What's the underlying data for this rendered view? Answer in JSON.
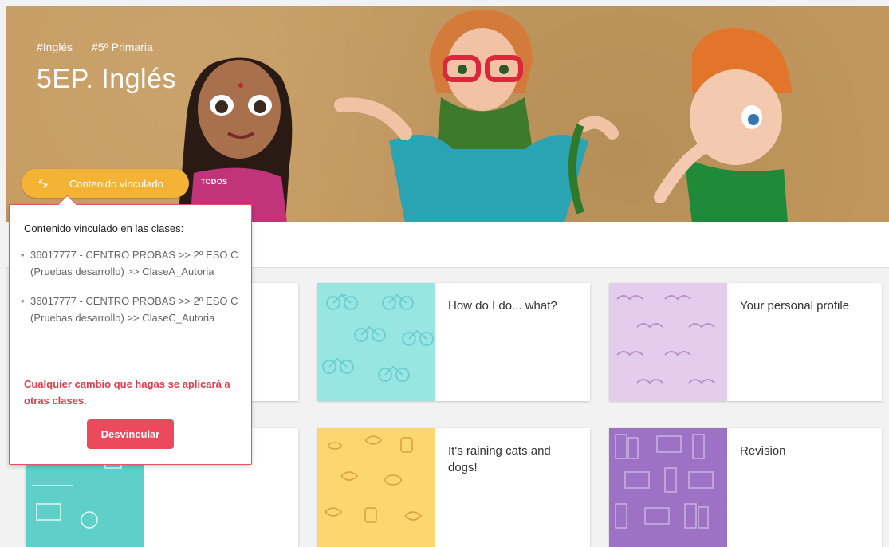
{
  "hero": {
    "tags": [
      "#Inglés",
      "#5º Primaria"
    ],
    "title": "5EP. Inglés",
    "linked_button_label": "Contenido vinculado",
    "linked_icon": "link-icon",
    "todos_tab_label": "TODOS"
  },
  "popover": {
    "heading": "Contenido vinculado en las clases:",
    "classes": [
      "36017777 - CENTRO PROBAS >> 2º ESO C (Pruebas desarrollo) >> ClaseA_Autoria",
      "36017777 - CENTRO PROBAS >> 2º ESO C (Pruebas desarrollo) >> ClaseC_Autoria"
    ],
    "warning": "Cualquier cambio que hagas se aplicará a otras clases.",
    "unlink_button": "Desvincular"
  },
  "cards": [
    {
      "title": "How do I do... what?",
      "pattern": "bicycles"
    },
    {
      "title": "Your personal profile",
      "pattern": "moustaches"
    },
    {
      "title": "It's raining cats and dogs!",
      "pattern": "teapots-leaves"
    },
    {
      "title": "Revision",
      "pattern": "books"
    },
    {
      "title": "",
      "pattern": "london"
    }
  ],
  "colors": {
    "accent_orange": "#f5b335",
    "danger_red": "#ec4a5c",
    "hero_bg": "#c59a5f"
  }
}
